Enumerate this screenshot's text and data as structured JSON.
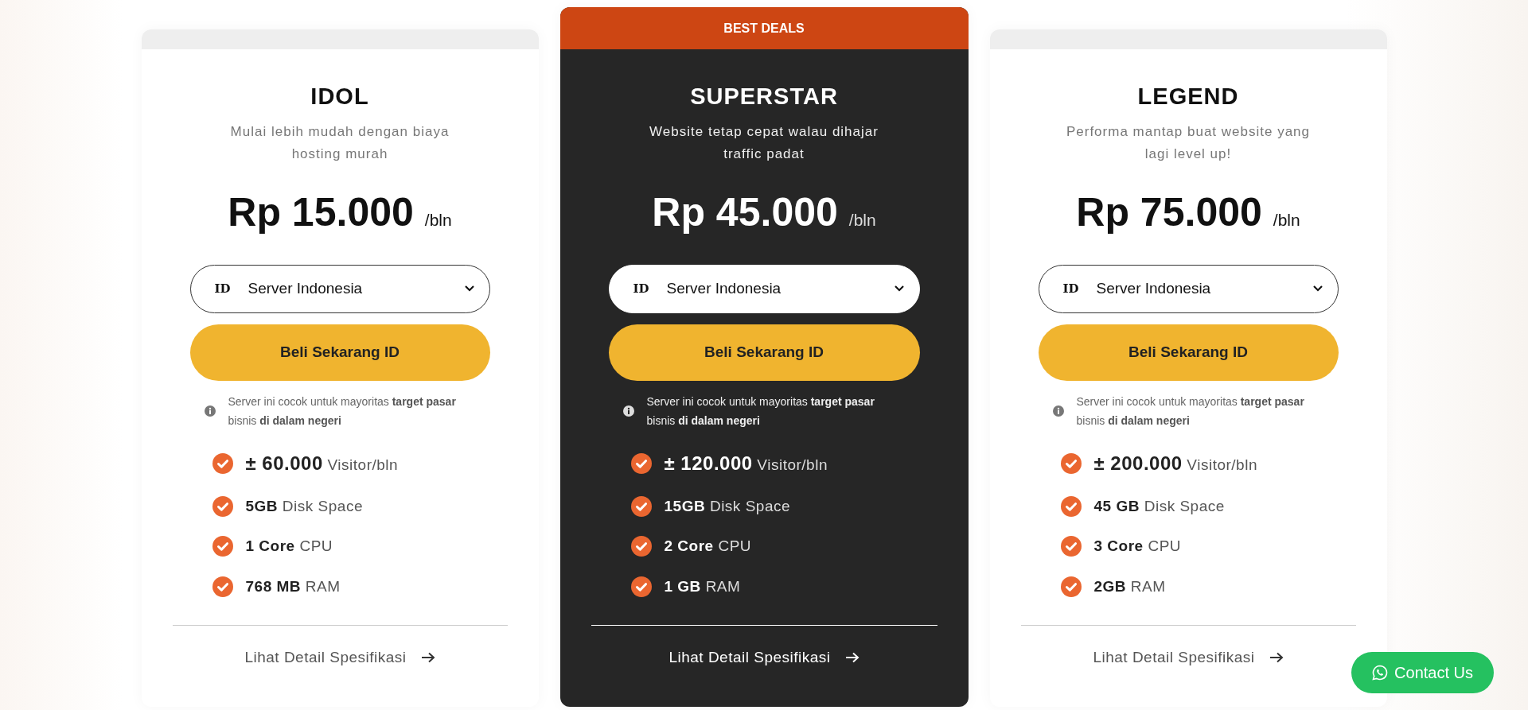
{
  "plans": [
    {
      "featured": false,
      "name": "IDOL",
      "description": "Mulai lebih mudah dengan biaya hosting murah",
      "price": "Rp 15.000",
      "period": "/bln",
      "server": {
        "flag": "ID",
        "value": "Server Indonesia"
      },
      "buy_button": "Beli Sekarang ID",
      "note": "Server ini cocok untuk mayoritas **target pasar** bisnis **di dalam negeri**",
      "features": [
        "**± 60.000** Visitor/bln",
        "**5GB** Disk Space",
        "**1 Core** CPU",
        "**768 MB** RAM"
      ],
      "detail_link": "Lihat Detail Spesifikasi"
    },
    {
      "featured": true,
      "badge": "BEST DEALS",
      "name": "SUPERSTAR",
      "description": "Website tetap cepat walau dihajar traffic padat",
      "price": "Rp 45.000",
      "period": "/bln",
      "server": {
        "flag": "ID",
        "value": "Server Indonesia"
      },
      "buy_button": "Beli Sekarang ID",
      "note": "Server ini cocok untuk mayoritas **target pasar** bisnis **di dalam negeri**",
      "features": [
        "**± 120.000** Visitor/bln",
        "**15GB** Disk Space",
        "**2 Core** CPU",
        "**1 GB** RAM"
      ],
      "detail_link": "Lihat Detail Spesifikasi"
    },
    {
      "featured": false,
      "name": "LEGEND",
      "description": "Performa mantap buat website yang lagi level up!",
      "price": "Rp 75.000",
      "period": "/bln",
      "server": {
        "flag": "ID",
        "value": "Server Indonesia"
      },
      "buy_button": "Beli Sekarang ID",
      "note": "Server ini cocok untuk mayoritas **target pasar** bisnis **di dalam negeri**",
      "features": [
        "**± 200.000** Visitor/bln",
        "**45 GB** Disk Space",
        "**3 Core** CPU",
        "**2GB** RAM"
      ],
      "detail_link": "Lihat Detail Spesifikasi"
    }
  ],
  "contact_button": "Contact Us"
}
